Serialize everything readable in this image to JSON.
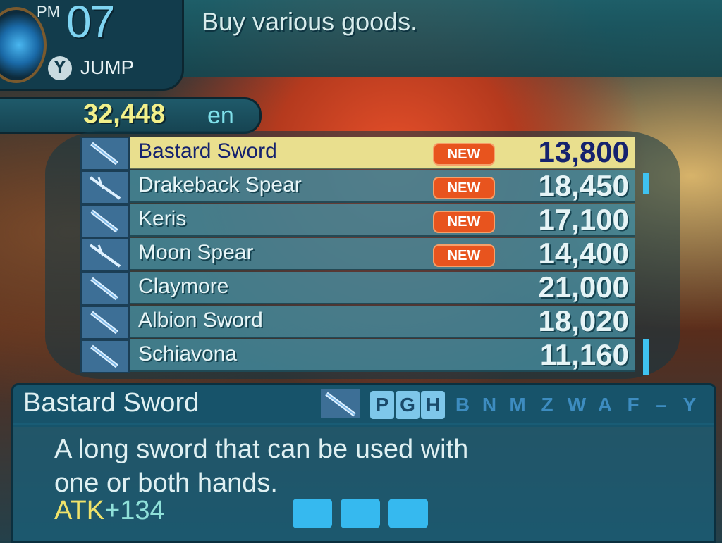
{
  "header": {
    "period": "PM",
    "hour": "07",
    "button_glyph": "Y",
    "button_action": "JUMP",
    "message": "Buy various goods."
  },
  "wallet": {
    "amount": "32,448",
    "unit": "en"
  },
  "shop_items": [
    {
      "name": "Bastard Sword",
      "badge": "NEW",
      "price": "13,800",
      "icon": "sword-icon",
      "selected": true
    },
    {
      "name": "Drakeback Spear",
      "badge": "NEW",
      "price": "18,450",
      "icon": "spear-icon",
      "selected": false
    },
    {
      "name": "Keris",
      "badge": "NEW",
      "price": "17,100",
      "icon": "sword-icon",
      "selected": false
    },
    {
      "name": "Moon Spear",
      "badge": "NEW",
      "price": "14,400",
      "icon": "spear-icon",
      "selected": false
    },
    {
      "name": "Claymore",
      "badge": "",
      "price": "21,000",
      "icon": "sword-icon",
      "selected": false
    },
    {
      "name": "Albion Sword",
      "badge": "",
      "price": "18,020",
      "icon": "sword-icon",
      "selected": false
    },
    {
      "name": "Schiavona",
      "badge": "",
      "price": "11,160",
      "icon": "sword-icon",
      "selected": false
    }
  ],
  "detail": {
    "name": "Bastard Sword",
    "icon": "sword-icon",
    "class_letters": [
      "P",
      "G",
      "H",
      "B",
      "N",
      "M",
      "Z",
      "W",
      "A",
      "F",
      "–",
      "Y"
    ],
    "class_enabled": [
      true,
      true,
      true,
      false,
      false,
      false,
      false,
      false,
      false,
      false,
      false,
      false
    ],
    "description_line1": "A long sword that can be used with",
    "description_line2": "one or both hands.",
    "stat_label": "ATK",
    "stat_value": "+134",
    "forge_slots": 3
  },
  "colors": {
    "selected_row": "#e9df8e",
    "badge": "#e8541e",
    "money": "#f2f08a",
    "slot": "#36b9ef"
  }
}
